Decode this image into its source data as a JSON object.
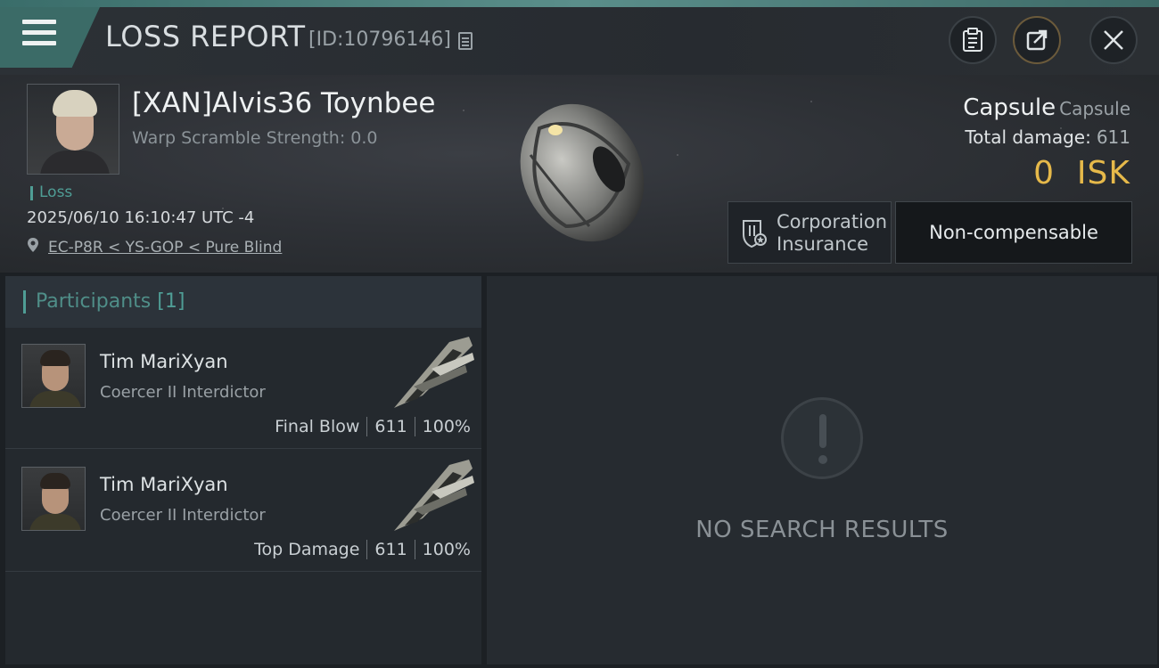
{
  "header": {
    "title": "LOSS REPORT",
    "report_id": "[ID:10796146]"
  },
  "victim": {
    "name": "[XAN]Alvis36 Toynbee",
    "warp_scramble": "Warp Scramble Strength: 0.0",
    "status": "Loss",
    "timestamp": "2025/06/10 16:10:47 UTC -4",
    "location": "EC-P8R < YS-GOP < Pure Blind"
  },
  "ship": {
    "name": "Capsule",
    "type": "Capsule",
    "total_damage_label": "Total damage:",
    "total_damage": "611",
    "isk_value": "0",
    "isk_unit": "ISK"
  },
  "insurance": {
    "label_line1": "Corporation",
    "label_line2": "Insurance",
    "status": "Non-compensable"
  },
  "participants": {
    "title": "Participants",
    "count": "[1]",
    "rows": [
      {
        "name": "Tim MariXyan",
        "ship": "Coercer II Interdictor",
        "role": "Final Blow",
        "damage": "611",
        "percent": "100%"
      },
      {
        "name": "Tim MariXyan",
        "ship": "Coercer II Interdictor",
        "role": "Top Damage",
        "damage": "611",
        "percent": "100%"
      }
    ]
  },
  "details": {
    "empty_message": "NO SEARCH RESULTS"
  },
  "colors": {
    "accent_teal": "#4f9d95",
    "isk_gold": "#e6b94a",
    "menu_tab": "#3b6b67"
  },
  "icons": [
    "menu-icon",
    "copy-icon",
    "clipboard-icon",
    "share-icon",
    "close-icon",
    "location-pin-icon",
    "insurance-icon",
    "alert-icon"
  ]
}
